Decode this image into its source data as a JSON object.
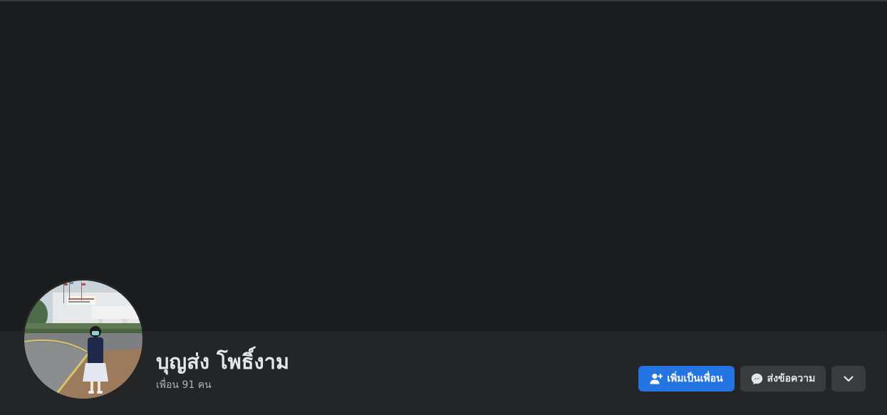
{
  "profile": {
    "name": "บุญส่ง โพธิ์งาม",
    "friends_count": "เพื่อน 91 คน"
  },
  "actions": {
    "add_friend_label": "เพิ่มเป็นเพื่อน",
    "message_label": "ส่งข้อความ",
    "add_friend_icon": "add-friend-icon",
    "message_icon": "messenger-icon",
    "more_icon": "chevron-down-icon"
  },
  "colors": {
    "page_bg": "#18191a",
    "header_bg": "#242526",
    "primary_button": "#2374e1",
    "secondary_button": "#3a3b3c",
    "primary_text": "#e4e6eb",
    "secondary_text": "#b0b3b8"
  }
}
